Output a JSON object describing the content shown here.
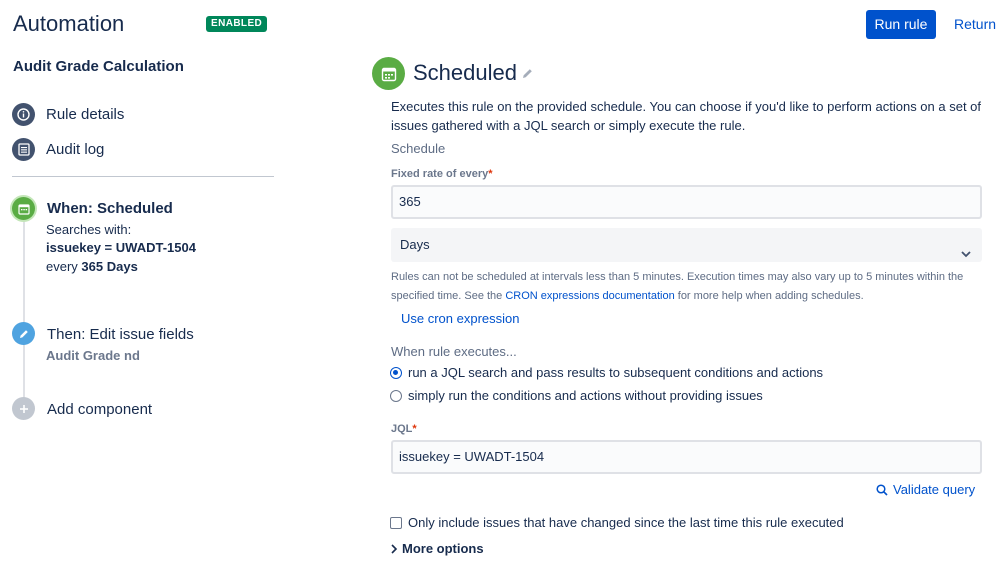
{
  "header": {
    "app_title": "Automation",
    "status_badge": "ENABLED",
    "run_button": "Run rule",
    "return_link": "Return t"
  },
  "sidebar": {
    "rule_name": "Audit Grade Calculation",
    "nav": [
      {
        "label": "Rule details",
        "icon": "info-icon"
      },
      {
        "label": "Audit log",
        "icon": "list-icon"
      }
    ],
    "components": {
      "trigger": {
        "title": "When: Scheduled",
        "searches_label": "Searches with:",
        "query": "issuekey = UWADT-1504",
        "every_prefix": "every",
        "every_value": "365 Days",
        "icon": "calendar-icon"
      },
      "action": {
        "title": "Then: Edit issue fields",
        "subtitle": "Audit Grade nd",
        "icon": "pencil-icon"
      },
      "add": {
        "label": "Add component",
        "icon": "plus-icon"
      }
    }
  },
  "main": {
    "title": "Scheduled",
    "description": "Executes this rule on the provided schedule. You can choose if you'd like to perform actions on a set of issues gathered with a JQL search or simply execute the rule.",
    "schedule_label": "Schedule",
    "fixed_rate_label": "Fixed rate of every",
    "fixed_rate_value": "365",
    "unit_value": "Days",
    "help_before": "Rules can not be scheduled at intervals less than 5 minutes. Execution times may also vary up to 5 minutes within the specified time. See the ",
    "help_link": "CRON expressions documentation",
    "help_after": " for more help when adding schedules.",
    "cron_link": "Use cron expression",
    "when_executes_label": "When rule executes...",
    "radio_options": [
      {
        "label": "run a JQL search and pass results to subsequent conditions and actions",
        "selected": true
      },
      {
        "label": "simply run the conditions and actions without providing issues",
        "selected": false
      }
    ],
    "jql_label": "JQL",
    "jql_value": "issuekey = UWADT-1504",
    "validate_link": "Validate query",
    "only_changed_label": "Only include issues that have changed since the last time this rule executed",
    "only_changed_checked": false,
    "more_options": "More options"
  },
  "colors": {
    "primary": "#0052cc",
    "enabled_green": "#00875a",
    "trigger_green": "#5aac44",
    "action_blue": "#4fa3e0",
    "nav_icon": "#42526e",
    "required": "#de350b"
  }
}
